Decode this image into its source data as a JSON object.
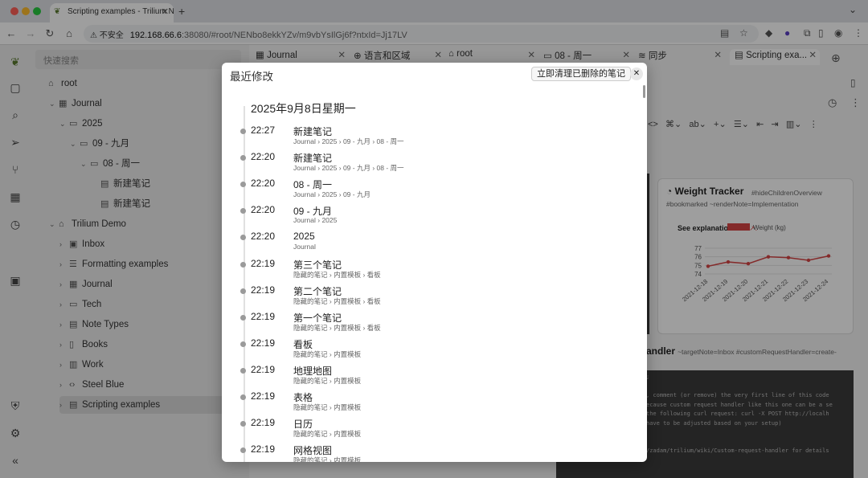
{
  "browser": {
    "tab_title": "Scripting examples - Trilium N",
    "url_insecure": "不安全",
    "url_host": "192.168.66.6",
    "url_path": ":38080/#root/NENbo8ekkYZv/m9vbYsIlGj6f?ntxId=Jj17LV"
  },
  "sidebar": {
    "search_placeholder": "快速搜索",
    "tree": [
      {
        "label": "root",
        "icon": "⌂",
        "depth": 0,
        "caret": ""
      },
      {
        "label": "Journal",
        "icon": "▦",
        "depth": 1,
        "caret": "⌄"
      },
      {
        "label": "2025",
        "icon": "▭",
        "depth": 2,
        "caret": "⌄"
      },
      {
        "label": "09 - 九月",
        "icon": "▭",
        "depth": 3,
        "caret": "⌄"
      },
      {
        "label": "08 - 周一",
        "icon": "▭",
        "depth": 4,
        "caret": "⌄"
      },
      {
        "label": "新建笔记",
        "icon": "▤",
        "depth": 5,
        "caret": ""
      },
      {
        "label": "新建笔记",
        "icon": "▤",
        "depth": 5,
        "caret": ""
      },
      {
        "label": "Trilium Demo",
        "icon": "⌂",
        "depth": 1,
        "caret": "⌄"
      },
      {
        "label": "Inbox",
        "icon": "▣",
        "depth": 2,
        "caret": "›"
      },
      {
        "label": "Formatting examples",
        "icon": "☰",
        "depth": 2,
        "caret": "›"
      },
      {
        "label": "Journal",
        "icon": "▦",
        "depth": 2,
        "caret": "›"
      },
      {
        "label": "Tech",
        "icon": "▭",
        "depth": 2,
        "caret": "›"
      },
      {
        "label": "Note Types",
        "icon": "▤",
        "depth": 2,
        "caret": "›"
      },
      {
        "label": "Books",
        "icon": "▯",
        "depth": 2,
        "caret": "›"
      },
      {
        "label": "Work",
        "icon": "▥",
        "depth": 2,
        "caret": "›"
      },
      {
        "label": "Steel Blue",
        "icon": "‹›",
        "depth": 2,
        "caret": "›"
      },
      {
        "label": "Scripting examples",
        "icon": "▤",
        "depth": 2,
        "caret": "›"
      }
    ]
  },
  "content_tabs": [
    {
      "label": "Journal",
      "icon": "▦"
    },
    {
      "label": "语言和区域",
      "icon": "⊕"
    },
    {
      "label": "root",
      "icon": "⌂"
    },
    {
      "label": "08 - 周一",
      "icon": "▭"
    },
    {
      "label": "同步",
      "icon": "≋"
    },
    {
      "label": "Scripting exa...",
      "icon": "▤"
    }
  ],
  "weight_card": {
    "title": "Weight Tracker",
    "tags": "#hideChildrenOverview #bookmarked ~renderNote=Implementation",
    "see_text": "See explanation",
    "see_link": "here",
    "legend": "Weight (kg)"
  },
  "chart_data": {
    "type": "line",
    "x": [
      "2021-12-18",
      "2021-12-19",
      "2021-12-20",
      "2021-12-21",
      "2021-12-22",
      "2021-12-23",
      "2021-12-24"
    ],
    "series": [
      {
        "name": "Weight (kg)",
        "values": [
          74.9,
          75.4,
          75.2,
          76.0,
          75.9,
          75.6,
          76.1
        ]
      }
    ],
    "ylim": [
      74,
      77
    ],
    "yticks": [
      "77",
      "76",
      "75",
      "74"
    ],
    "color": "#d64545"
  },
  "handler_card": {
    "title": "andler",
    "tags": "~targetNote=Inbox #customRequestHandler=create-",
    "code": [
      ";",
      "",
      ", comment (or remove) the very first line of this code",
      "ecause custom request handler like this one can be a se",
      " the following curl request: curl -X POST http://localh",
      "have to be adjusted based on your setup)",
      "",
      "",
      "/zadam/trilium/wiki/Custom-request-handler for details"
    ]
  },
  "modal": {
    "title": "最近修改",
    "purge_label": "立即清理已删除的笔记",
    "close_label": "✕",
    "date": "2025年9月8日星期一",
    "entries": [
      {
        "time": "22:27",
        "title": "新建笔记",
        "path": [
          "Journal",
          "2025",
          "09 - 九月",
          "08 - 周一"
        ]
      },
      {
        "time": "22:20",
        "title": "新建笔记",
        "path": [
          "Journal",
          "2025",
          "09 - 九月",
          "08 - 周一"
        ]
      },
      {
        "time": "22:20",
        "title": "08 - 周一",
        "path": [
          "Journal",
          "2025",
          "09 - 九月"
        ]
      },
      {
        "time": "22:20",
        "title": "09 - 九月",
        "path": [
          "Journal",
          "2025"
        ]
      },
      {
        "time": "22:20",
        "title": "2025",
        "path": [
          "Journal"
        ]
      },
      {
        "time": "22:19",
        "title": "第三个笔记",
        "path": [
          "隐藏的笔记",
          "内置模板",
          "看板"
        ]
      },
      {
        "time": "22:19",
        "title": "第二个笔记",
        "path": [
          "隐藏的笔记",
          "内置模板",
          "看板"
        ]
      },
      {
        "time": "22:19",
        "title": "第一个笔记",
        "path": [
          "隐藏的笔记",
          "内置模板",
          "看板"
        ]
      },
      {
        "time": "22:19",
        "title": "看板",
        "path": [
          "隐藏的笔记",
          "内置模板"
        ]
      },
      {
        "time": "22:19",
        "title": "地理地图",
        "path": [
          "隐藏的笔记",
          "内置模板"
        ]
      },
      {
        "time": "22:19",
        "title": "表格",
        "path": [
          "隐藏的笔记",
          "内置模板"
        ]
      },
      {
        "time": "22:19",
        "title": "日历",
        "path": [
          "隐藏的笔记",
          "内置模板"
        ]
      },
      {
        "time": "22:19",
        "title": "网格视图",
        "path": [
          "隐藏的笔记",
          "内置模板"
        ]
      }
    ]
  }
}
